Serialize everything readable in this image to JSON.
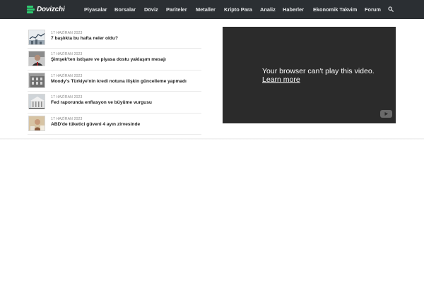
{
  "header": {
    "logo_text": "Dovizchi",
    "brand_color": "#2ecc71",
    "nav": [
      {
        "label": "Piyasalar"
      },
      {
        "label": "Borsalar"
      },
      {
        "label": "Döviz"
      },
      {
        "label": "Pariteler"
      },
      {
        "label": "Metaller"
      },
      {
        "label": "Kripto Para"
      },
      {
        "label": "Analiz"
      },
      {
        "label": "Haberler"
      },
      {
        "label": "Ekonomik Takvim"
      },
      {
        "label": "Forum"
      }
    ],
    "search_icon": "search-icon"
  },
  "news": [
    {
      "date": "17 HAZİRAN 2023",
      "title": "7 başlıkta bu hafta neler oldu?",
      "thumb": "chart-thumbnail"
    },
    {
      "date": "17 HAZİRAN 2023",
      "title": "Şimşek'ten istişare ve piyasa dostu yaklaşım mesajı",
      "thumb": "person-thumbnail"
    },
    {
      "date": "17 HAZİRAN 2023",
      "title": "Moody’s Türkiye'nin kredi notuna ilişkin güncelleme yapmadı",
      "thumb": "building-thumbnail"
    },
    {
      "date": "17 HAZİRAN 2023",
      "title": "Fed raporunda enflasyon ve büyüme vurgusu",
      "thumb": "fed-building-thumbnail"
    },
    {
      "date": "17 HAZİRAN 2023",
      "title": "ABD'de tüketici güveni 4 ayın zirvesinde",
      "thumb": "shopper-thumbnail"
    }
  ],
  "video": {
    "message": "Your browser can't play this video.",
    "link": "Learn more",
    "logo_icon": "youtube-icon"
  }
}
